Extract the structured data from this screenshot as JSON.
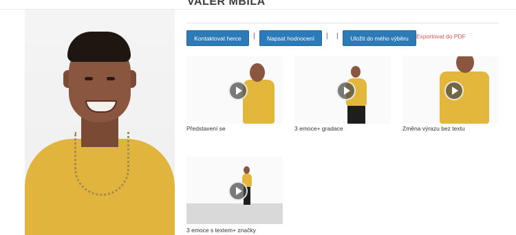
{
  "actor": {
    "name": "VALER MBILA"
  },
  "actions": {
    "contact": "Kontaktovat herce",
    "rate": "Napsat hodnocení",
    "save": "Uložit do mého výběru",
    "separator": "|",
    "export_pdf": "Exportovat do PDF"
  },
  "videos": [
    {
      "caption": "Představení se"
    },
    {
      "caption": "3 emoce+ gradace"
    },
    {
      "caption": "Změna výrazu bez textu"
    },
    {
      "caption": "3 emoce s textem+ značky"
    }
  ],
  "colors": {
    "button": "#2c7ab8",
    "link": "#d9534f",
    "shirt": "#e1b43d"
  }
}
